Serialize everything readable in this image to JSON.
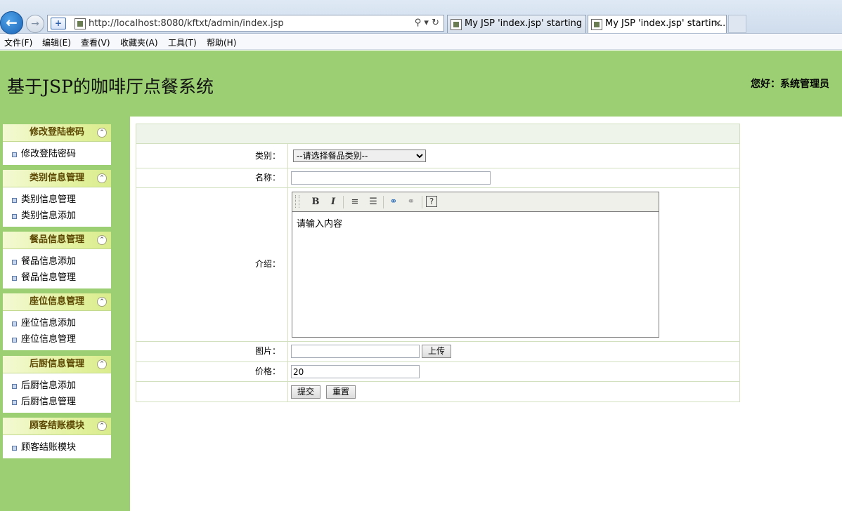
{
  "browser": {
    "url": "http://localhost:8080/kftxt/admin/index.jsp",
    "tabs": [
      {
        "label": "My JSP 'index.jsp' starting p..."
      },
      {
        "label": "My JSP 'index.jsp' startin..."
      }
    ],
    "menu": [
      "文件(F)",
      "编辑(E)",
      "查看(V)",
      "收藏夹(A)",
      "工具(T)",
      "帮助(H)"
    ]
  },
  "header": {
    "title": "基于JSP的咖啡厅点餐系统",
    "greeting": "您好：系统管理员"
  },
  "sidebar": {
    "panels": [
      {
        "title": "修改登陆密码",
        "items": [
          "修改登陆密码"
        ]
      },
      {
        "title": "类别信息管理",
        "items": [
          "类别信息管理",
          "类别信息添加"
        ]
      },
      {
        "title": "餐品信息管理",
        "items": [
          "餐品信息添加",
          "餐品信息管理"
        ]
      },
      {
        "title": "座位信息管理",
        "items": [
          "座位信息添加",
          "座位信息管理"
        ]
      },
      {
        "title": "后厨信息管理",
        "items": [
          "后厨信息添加",
          "后厨信息管理"
        ]
      },
      {
        "title": "顾客结账模块",
        "items": [
          "顾客结账模块"
        ]
      }
    ]
  },
  "form": {
    "type_label": "类别：",
    "type_selected": "--请选择餐品类别--",
    "name_label": "名称：",
    "name_value": "",
    "intro_label": "介绍：",
    "intro_value": "请输入内容",
    "image_label": "图片：",
    "image_value": "",
    "upload_button": "上传",
    "price_label": "价格：",
    "price_value": "20",
    "submit_button": "提交",
    "reset_button": "重置"
  },
  "editor_toolbar": {
    "bold": "B",
    "italic": "I"
  }
}
